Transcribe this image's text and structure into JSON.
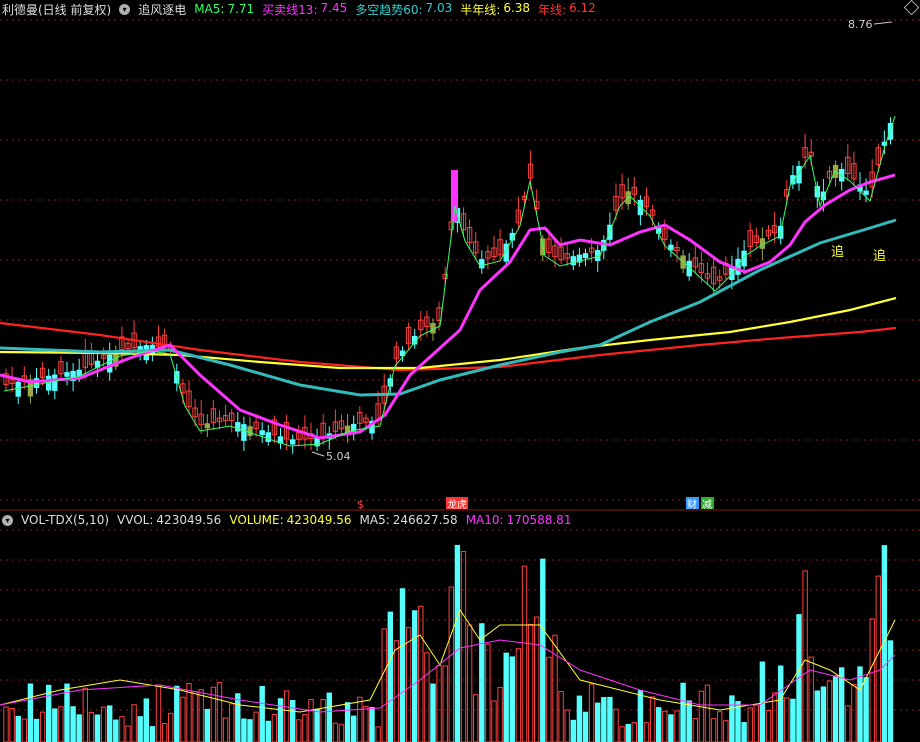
{
  "header": {
    "stock_name": "利德曼(日线 前复权)",
    "formula_name": "追风逐电",
    "ma5_label": "MA5:",
    "ma5_value": "7.71",
    "buy_label": "买卖线13:",
    "buy_value": "7.45",
    "trend_label": "多空趋势60:",
    "trend_value": "7.03",
    "half_label": "半年线:",
    "half_value": "6.38",
    "year_label": "年线:",
    "year_value": "6.12"
  },
  "price_chart": {
    "high_label": "8.76",
    "low_label": "5.04",
    "signal_label_1": "追",
    "signal_label_2": "追",
    "event_markers": [
      "$",
      "龙虎",
      "财",
      "减"
    ]
  },
  "volume_panel": {
    "title": "VOL-TDX(5,10)",
    "vvol_label": "VVOL:",
    "vvol_value": "423049.56",
    "volume_label": "VOLUME:",
    "volume_value": "423049.56",
    "ma5_label": "MA5:",
    "ma5_value": "246627.58",
    "ma10_label": "MA10:",
    "ma10_value": "170588.81"
  },
  "colors": {
    "up": "#ff4040",
    "down": "#55ffff",
    "olive": "#99aa44",
    "ma5": "#33ff66",
    "buy_line": "#ff33ff",
    "trend": "#33bbbb",
    "half_year": "#ffff33",
    "year": "#ff2222",
    "grid": "#8b1a1a"
  }
}
